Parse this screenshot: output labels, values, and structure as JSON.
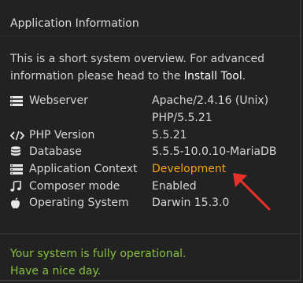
{
  "panel": {
    "title": "Application Information",
    "intro_text": "This is a short system overview. For advanced information please head to the ",
    "intro_link": "Install Tool",
    "intro_end": "."
  },
  "rows": [
    {
      "icon": "server-icon",
      "label": "Webserver",
      "value": "Apache/2.4.16 (Unix)",
      "value2": "PHP/5.5.21"
    },
    {
      "icon": "code-icon",
      "label": "PHP Version",
      "value": "5.5.21"
    },
    {
      "icon": "database-icon",
      "label": "Database",
      "value": "5.5.5-10.0.10-MariaDB"
    },
    {
      "icon": "server-icon",
      "label": "Application Context",
      "value": "Development"
    },
    {
      "icon": "music-note-icon",
      "label": "Composer mode",
      "value": "Enabled"
    },
    {
      "icon": "apple-icon",
      "label": "Operating System",
      "value": "Darwin 15.3.0"
    }
  ],
  "status": {
    "line1": "Your system is fully operational.",
    "line2": "Have a nice day."
  },
  "colors": {
    "background": "#222222",
    "context_value": "#f4a11a",
    "status_text": "#86c23c",
    "annotation_arrow": "#e8312a"
  }
}
